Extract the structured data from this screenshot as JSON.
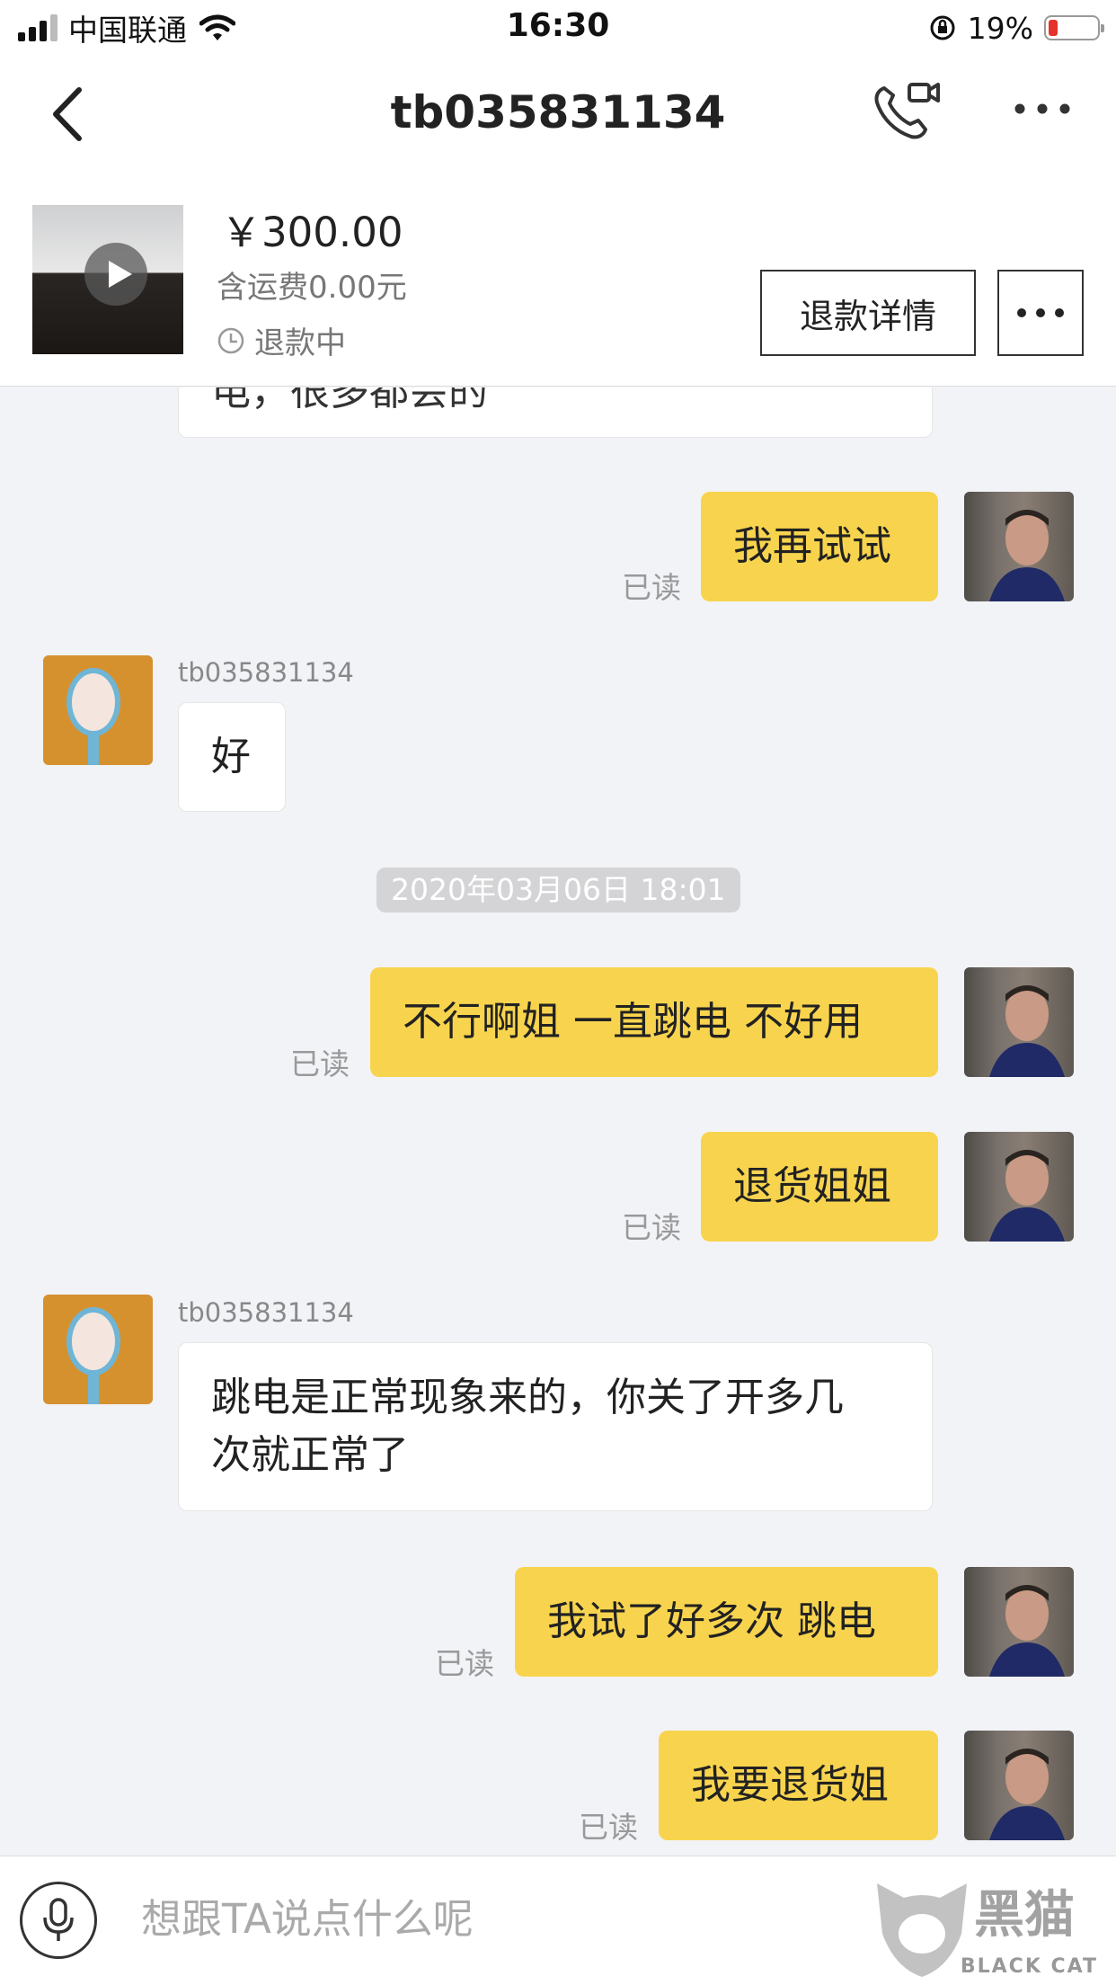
{
  "status_bar": {
    "carrier": "中国联通",
    "time": "16:30",
    "battery_pct": "19%",
    "battery_level": 0.19,
    "battery_color": "#e5322d"
  },
  "nav": {
    "title": "tb035831134",
    "back_icon": "chevron-left-icon",
    "call_icon": "phone-video-icon",
    "more_icon": "ellipsis-icon"
  },
  "order": {
    "price": "￥300.00",
    "shipping": "含运费0.00元",
    "status": "退款中",
    "refund_button": "退款详情"
  },
  "messages": [
    {
      "side": "in",
      "text": "电，很多都会的",
      "clipped": true
    },
    {
      "side": "out",
      "text": "我再试试",
      "read": "已读"
    },
    {
      "side": "in",
      "sender": "tb035831134",
      "text": "好"
    },
    {
      "type": "time",
      "text": "2020年03月06日 18:01"
    },
    {
      "side": "out",
      "text": "不行啊姐 一直跳电 不好用",
      "read": "已读"
    },
    {
      "side": "out",
      "text": "退货姐姐",
      "read": "已读"
    },
    {
      "side": "in",
      "sender": "tb035831134",
      "text_line1": "跳电是正常现象来的，你关了开多几",
      "text_line2": "次就正常了"
    },
    {
      "side": "out",
      "text": "我试了好多次 跳电",
      "read": "已读"
    },
    {
      "side": "out",
      "text": "我要退货姐",
      "read": "已读"
    }
  ],
  "input": {
    "placeholder": "想跟TA说点什么呢"
  },
  "watermark": {
    "cn": "黑猫",
    "en": "BLACK CAT"
  },
  "colors": {
    "outgoing_bubble": "#f8d44e",
    "incoming_bubble": "#ffffff",
    "background": "#f2f3f7"
  }
}
